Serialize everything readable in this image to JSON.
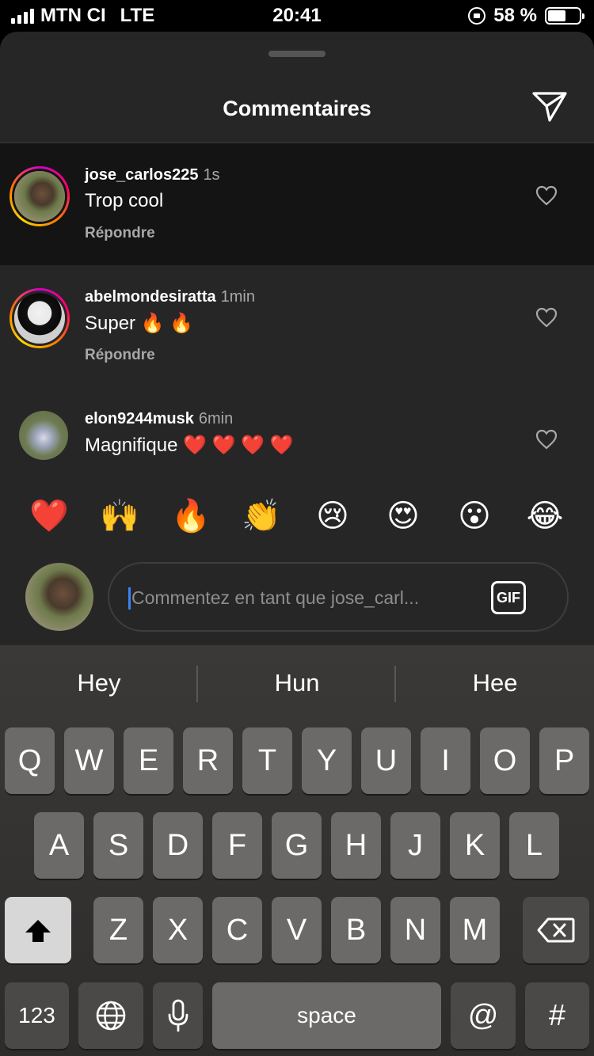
{
  "status_bar": {
    "carrier": "MTN CI",
    "network": "LTE",
    "time": "20:41",
    "battery": "58 %",
    "battery_level": 0.58
  },
  "sheet": {
    "title": "Commentaires"
  },
  "comments": [
    {
      "username": "jose_carlos225",
      "time": "1s",
      "text": "Trop cool",
      "reply_label": "Répondre"
    },
    {
      "username": "abelmondesiratta",
      "time": "1min",
      "text": "Super 🔥 🔥",
      "reply_label": "Répondre"
    },
    {
      "username": "elon9244musk",
      "time": "6min",
      "text": "Magnifique ❤️ ❤️ ❤️ ❤️"
    }
  ],
  "emoji_bar": [
    "❤️",
    "🙌",
    "🔥",
    "👏",
    "😢",
    "😍",
    "😮",
    "😂"
  ],
  "comment_input": {
    "placeholder": "Commentez en tant que jose_carl...",
    "gif_label": "GIF"
  },
  "keyboard": {
    "suggestions": [
      "Hey",
      "Hun",
      "Hee"
    ],
    "row1": [
      "Q",
      "W",
      "E",
      "R",
      "T",
      "Y",
      "U",
      "I",
      "O",
      "P"
    ],
    "row2": [
      "A",
      "S",
      "D",
      "F",
      "G",
      "H",
      "J",
      "K",
      "L"
    ],
    "row3": [
      "Z",
      "X",
      "C",
      "V",
      "B",
      "N",
      "M"
    ],
    "numbers_key": "123",
    "space_key": "space",
    "at_key": "@",
    "hash_key": "#"
  }
}
